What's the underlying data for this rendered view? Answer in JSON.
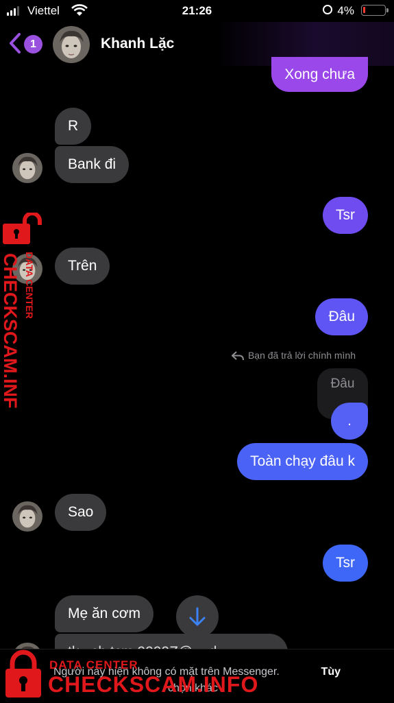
{
  "status_bar": {
    "carrier": "Viettel",
    "time": "21:26",
    "battery": "4%"
  },
  "header": {
    "back_badge": "1",
    "contact_name": "Khanh Lặc"
  },
  "messages": [
    {
      "dir": "out",
      "text": "Xong chưa"
    },
    {
      "dir": "in",
      "text": "R"
    },
    {
      "dir": "in",
      "text": "Bank đi"
    },
    {
      "dir": "out",
      "text": "Tsr"
    },
    {
      "dir": "in",
      "text": "Trên"
    },
    {
      "dir": "out",
      "text": "Đâu"
    },
    {
      "dir": "out",
      "text": ".",
      "reply_note": "Bạn đã trả lời chính mình",
      "quoted": "Đâu"
    },
    {
      "dir": "out",
      "text": "Toàn chạy đâu k"
    },
    {
      "dir": "in",
      "text": "Sao"
    },
    {
      "dir": "out",
      "text": "Tsr"
    },
    {
      "dir": "in",
      "text": "Mẹ ăn cơm"
    },
    {
      "dir": "in",
      "text": "tk ..ch tcm 9999Z@....d..."
    }
  ],
  "footer": {
    "notice": "Người này hiện không có mặt trên Messenger.",
    "more": "Tùy",
    "more2": "chọn khác"
  },
  "watermark": {
    "brand": "CHECKSCAM.INFO",
    "sub": "DATA CENTER"
  },
  "colors": {
    "accent": "#9b51e0",
    "out_purple": "#7c4dff",
    "out_blue": "#3f5efb",
    "incoming": "#3a3a3c",
    "watermark": "#e0181b"
  }
}
